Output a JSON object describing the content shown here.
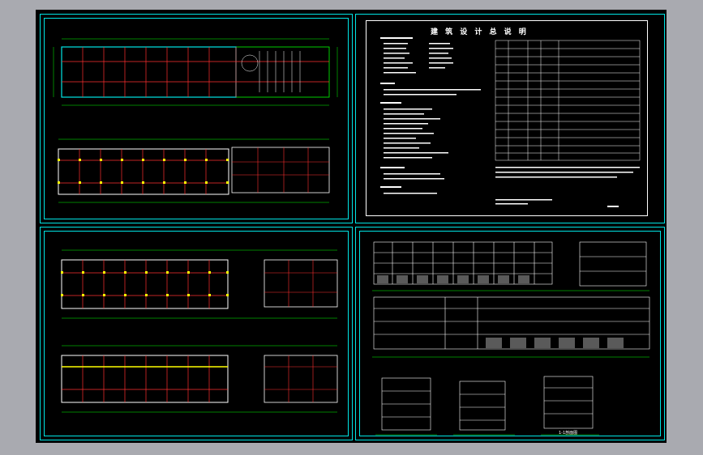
{
  "sheets": {
    "notes": {
      "title": "建 筑 设 计 总 说 明"
    },
    "elevations": {
      "section_label": "1-1剖面图"
    }
  },
  "colors": {
    "background": "#a9aab0",
    "drawing_bg": "#000000",
    "frame": "#00e5e5",
    "grid_line": "#ff3030",
    "column": "#ffff00",
    "dimension": "#00ff00",
    "text": "#ffffff"
  }
}
